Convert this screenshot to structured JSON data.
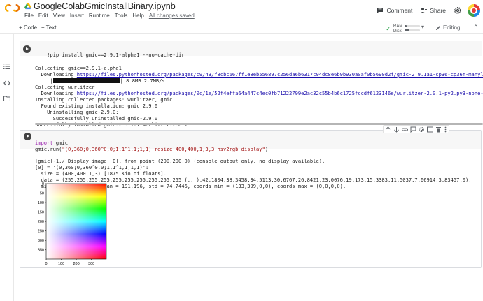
{
  "header": {
    "title": "GoogleColabGmicInstallBinary.ipynb",
    "menu": [
      "File",
      "Edit",
      "View",
      "Insert",
      "Runtime",
      "Tools",
      "Help"
    ],
    "changes_status": "All changes saved",
    "comment_label": "Comment",
    "share_label": "Share"
  },
  "toolbar": {
    "add_code": "+ Code",
    "add_text": "+ Text",
    "ram_label": "RAM",
    "disk_label": "Disk",
    "ram_usage": 0.12,
    "disk_usage": 0.3,
    "mode_label": "Editing"
  },
  "cell1": {
    "code": "!pip install gmic==2.9.1-alpha1 --no-cache-dir",
    "output": {
      "l1": "Collecting gmic==2.9.1-alpha1",
      "l2_pre": "  Downloading ",
      "l2_link": "https://files.pythonhosted.org/packages/c9/43/f8cbc667ff1e8eb556897c256da6b6317c94dc8e6b9b930a0af0b5690d2f/gmic-2.9.1a1-cp36-cp36m-manylinux20",
      "l3_pre": "     |",
      "l3_post": "| 8.8MB 2.7MB/s",
      "l4": "Collecting wurlitzer",
      "l5_pre": "  Downloading ",
      "l5_link": "https://files.pythonhosted.org/packages/0c/1e/52f4effa64a447c4ec0fb71222799e2ac32c55b4b6c1725fccdf6123146e/wurlitzer-2.0.1-py2.py3-none-any.wh",
      "l6": "Installing collected packages: wurlitzer, gmic",
      "l7": "  Found existing installation: gmic 2.9.0",
      "l8": "    Uninstalling gmic-2.9.0:",
      "l9": "      Successfully uninstalled gmic-2.9.0",
      "l10": "Successfully installed gmic-2.9.1a1 wurlitzer-2.0.1"
    }
  },
  "cell2": {
    "code_l1_kw": "import",
    "code_l1_rest": " gmic",
    "code_l2_pre": "gmic.run(",
    "code_l2_str": "\"(0,360;0,360^0,0;1,1^1,1;1,1) resize 400,400,1,3,3 hsv2rgb display\"",
    "code_l2_post": ")",
    "output": {
      "l1": "[gmic]-1./ Display image [0], from point (200,200,0) (console output only, no display available).",
      "l2": "[0] = '(0,360;0,360^0,0;1,1^1,1;1,1)':",
      "l3": "  size = (400,400,1,3) [1875 Kio of floats].",
      "l4": "  data = (255,255,255,255,255,255,255,255,255,255,(...),42.1804,38.3458,34.5113,30.6767,26.8421,23.0076,19.173,15.3383,11.5037,7.66914,3.83457,0).",
      "l5": "  min = 0, max = 255, mean = 191.196, std = 74.7446, coords_min = (133,399,0,0), coords_max = (0,0,0,0)."
    }
  },
  "chart_data": {
    "type": "heatmap",
    "title": "",
    "xlabel": "",
    "ylabel": "",
    "xlim": [
      0,
      399
    ],
    "ylim": [
      399,
      0
    ],
    "x_ticks": [
      0,
      100,
      200,
      300
    ],
    "y_ticks": [
      0,
      50,
      100,
      150,
      200,
      250,
      300,
      350
    ],
    "grid": false
  }
}
